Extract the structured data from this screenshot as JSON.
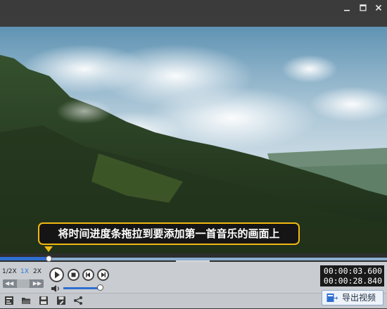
{
  "window": {
    "minimize_icon": "minimize-icon",
    "maximize_icon": "maximize-icon",
    "close_icon": "close-icon"
  },
  "video": {
    "scene": "forest-mountain-clouds"
  },
  "tooltip": {
    "text": "将时间进度条拖拉到要添加第一首音乐的画面上"
  },
  "playback": {
    "progress_fraction": 0.126,
    "speed_options": [
      "1/2X",
      "1X",
      "2X"
    ],
    "speed_selected": "1X",
    "current_time": "00:00:03.600",
    "total_time": "00:00:28.840",
    "volume_fraction": 1.0
  },
  "bottom_toolbar": {
    "icons": [
      "new-project-icon",
      "open-folder-icon",
      "save-icon",
      "save-as-icon",
      "share-icon"
    ],
    "export_label": "导出视频"
  },
  "colors": {
    "accent": "#2f6fd0",
    "tooltip_border": "#f1b711"
  }
}
